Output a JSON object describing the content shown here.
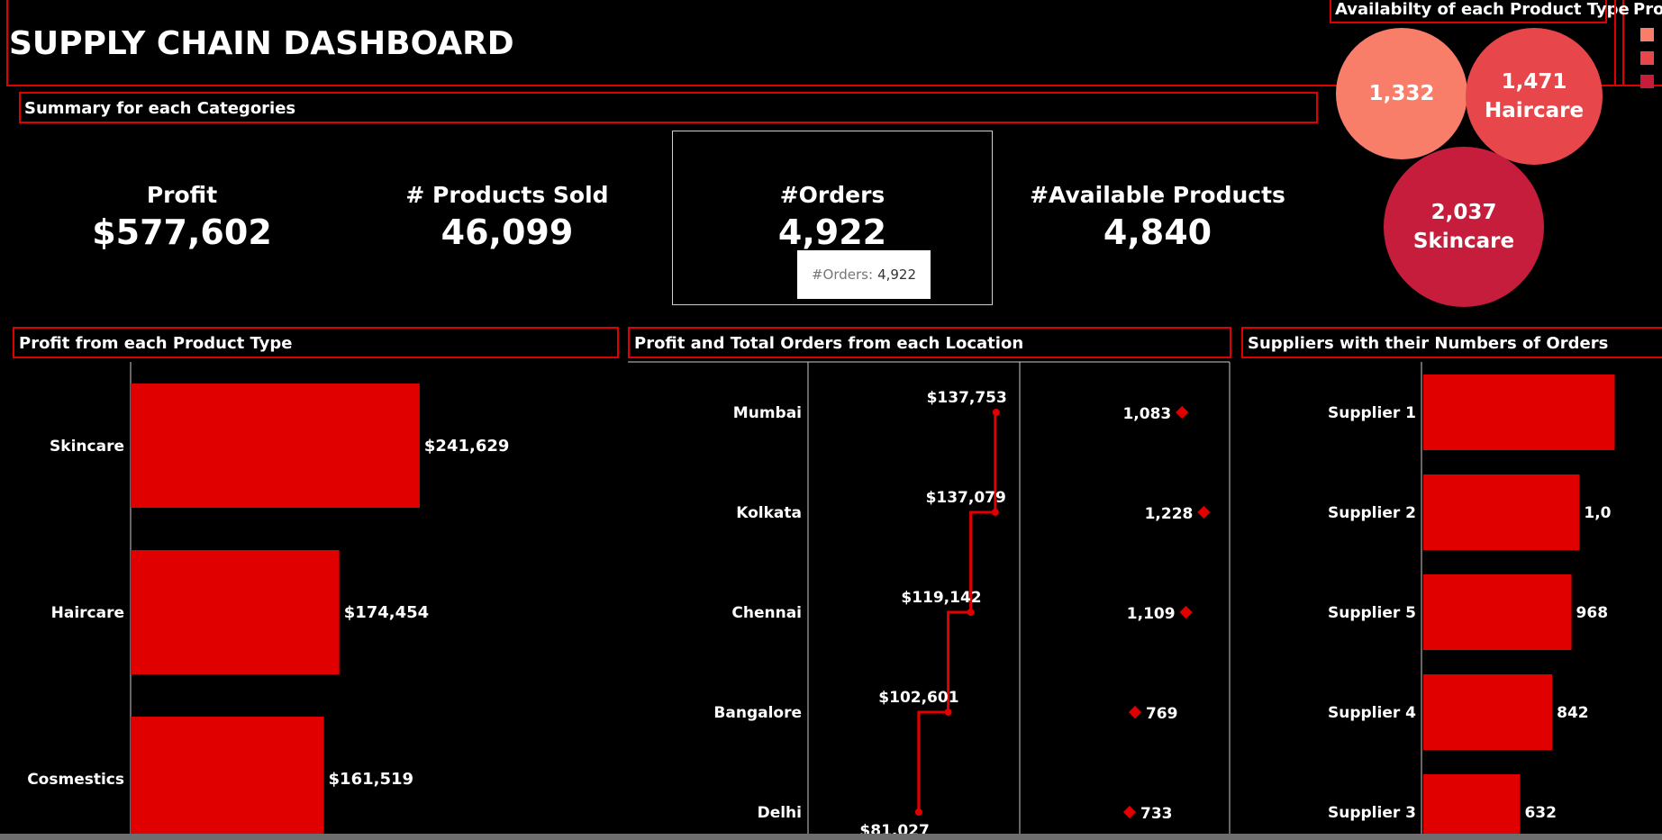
{
  "header": {
    "title": "SUPPLY CHAIN DASHBOARD"
  },
  "summary": {
    "title": "Summary for  each Categories",
    "kpis": [
      {
        "label": "Profit",
        "value": "$577,602"
      },
      {
        "label": "# Products Sold",
        "value": "46,099"
      },
      {
        "label": "#Orders",
        "value": "4,922"
      },
      {
        "label": "#Available Products",
        "value": "4,840"
      }
    ],
    "tooltip": {
      "label": "#Orders:",
      "value": "4,922"
    }
  },
  "availability": {
    "title": "Availabilty of each Product Type",
    "bubbles": [
      {
        "value": "1,332",
        "name": "",
        "color": "#f87e6a"
      },
      {
        "value": "1,471",
        "name": "Haircare",
        "color": "#e7474a"
      },
      {
        "value": "2,037",
        "name": "Skincare",
        "color": "#c51d3b"
      }
    ],
    "legend_title": "Pro",
    "legend_colors": [
      "#f87e6a",
      "#e7474a",
      "#c51d3b"
    ]
  },
  "colors": {
    "accent": "#e00000",
    "background": "#000000",
    "axis": "#cccccc"
  },
  "charts": {
    "profit_by_type": {
      "title": "Profit from each Product Type",
      "chart_data": {
        "type": "bar",
        "orientation": "horizontal",
        "categories": [
          "Skincare",
          "Haircare",
          "Cosmestics"
        ],
        "values": [
          241629,
          174454,
          161519
        ],
        "value_labels": [
          "$241,629",
          "$174,454",
          "$161,519"
        ],
        "xlim": [
          0,
          320000
        ]
      }
    },
    "location": {
      "title": "Profit and Total Orders from each Location",
      "chart_data": {
        "type": "line",
        "categories": [
          "Mumbai",
          "Kolkata",
          "Chennai",
          "Bangalore",
          "Delhi"
        ],
        "series": [
          {
            "values": [
              137753,
              137079,
              119142,
              102601,
              81027
            ],
            "labels": [
              "$137,753",
              "$137,079",
              "$119,142",
              "$102,601",
              "$81,027"
            ]
          },
          {
            "values": [
              1083,
              1228,
              1109,
              769,
              733
            ],
            "labels": [
              "1,083",
              "1,228",
              "1,109",
              "769",
              "733"
            ]
          }
        ],
        "profit_range": [
          0,
          155000
        ],
        "orders_range": [
          0,
          1400
        ]
      }
    },
    "suppliers": {
      "title": "Suppliers with their Numbers of Orders",
      "chart_data": {
        "type": "bar",
        "orientation": "horizontal",
        "categories": [
          "Supplier 1",
          "Supplier 2",
          "Supplier 5",
          "Supplier 4",
          "Supplier 3"
        ],
        "values": [
          1250,
          1020,
          968,
          842,
          632
        ],
        "value_labels": [
          "",
          "1,0",
          "968",
          "842",
          "632"
        ],
        "xlim": [
          0,
          1000
        ]
      }
    }
  }
}
